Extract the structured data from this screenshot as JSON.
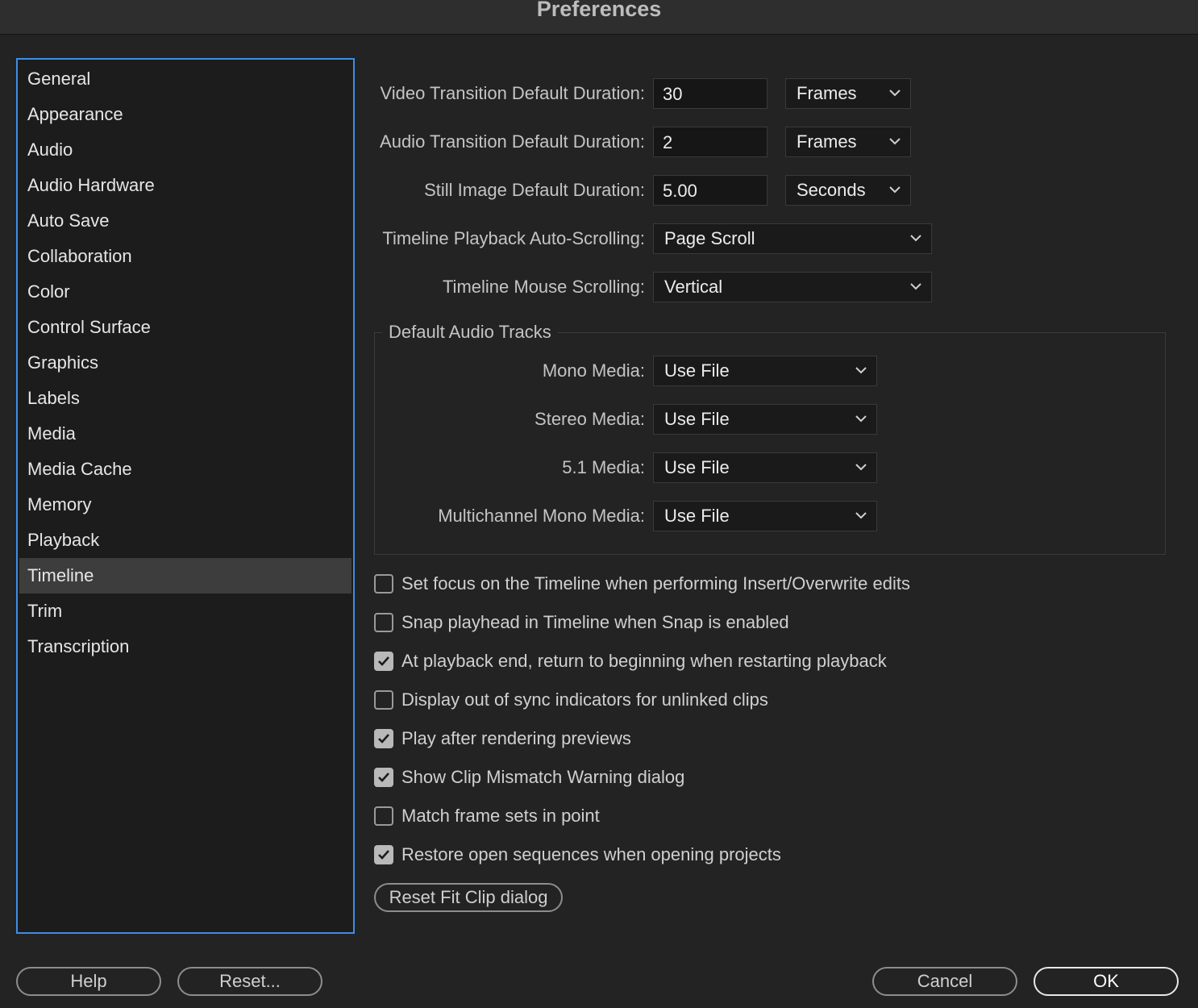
{
  "window": {
    "title": "Preferences"
  },
  "sidebar": {
    "items": [
      {
        "label": "General"
      },
      {
        "label": "Appearance"
      },
      {
        "label": "Audio"
      },
      {
        "label": "Audio Hardware"
      },
      {
        "label": "Auto Save"
      },
      {
        "label": "Collaboration"
      },
      {
        "label": "Color"
      },
      {
        "label": "Control Surface"
      },
      {
        "label": "Graphics"
      },
      {
        "label": "Labels"
      },
      {
        "label": "Media"
      },
      {
        "label": "Media Cache"
      },
      {
        "label": "Memory"
      },
      {
        "label": "Playback"
      },
      {
        "label": "Timeline"
      },
      {
        "label": "Trim"
      },
      {
        "label": "Transcription"
      }
    ],
    "selected": "Timeline"
  },
  "fields": {
    "video_transition": {
      "label": "Video Transition Default Duration:",
      "value": "30",
      "unit": "Frames"
    },
    "audio_transition": {
      "label": "Audio Transition Default Duration:",
      "value": "2",
      "unit": "Frames"
    },
    "still_image": {
      "label": "Still Image Default Duration:",
      "value": "5.00",
      "unit": "Seconds"
    },
    "auto_scrolling": {
      "label": "Timeline Playback Auto-Scrolling:",
      "value": "Page Scroll"
    },
    "mouse_scrolling": {
      "label": "Timeline Mouse Scrolling:",
      "value": "Vertical"
    }
  },
  "audio_tracks": {
    "title": "Default Audio Tracks",
    "mono": {
      "label": "Mono Media:",
      "value": "Use File"
    },
    "stereo": {
      "label": "Stereo Media:",
      "value": "Use File"
    },
    "surround": {
      "label": "5.1 Media:",
      "value": "Use File"
    },
    "multichannel": {
      "label": "Multichannel Mono Media:",
      "value": "Use File"
    }
  },
  "checkboxes": [
    {
      "label": "Set focus on the Timeline when performing Insert/Overwrite edits",
      "checked": false
    },
    {
      "label": "Snap playhead in Timeline when Snap is enabled",
      "checked": false
    },
    {
      "label": "At playback end, return to beginning when restarting playback",
      "checked": true
    },
    {
      "label": "Display out of sync indicators for unlinked clips",
      "checked": false
    },
    {
      "label": "Play after rendering previews",
      "checked": true
    },
    {
      "label": "Show Clip Mismatch Warning dialog",
      "checked": true
    },
    {
      "label": "Match frame sets in point",
      "checked": false
    },
    {
      "label": "Restore open sequences when opening projects",
      "checked": true
    }
  ],
  "buttons": {
    "reset_fit_clip": "Reset Fit Clip dialog",
    "help": "Help",
    "reset": "Reset...",
    "cancel": "Cancel",
    "ok": "OK"
  },
  "colors": {
    "accent": "#3d8ee6",
    "background": "#232323",
    "selected_item": "#3d3d3d"
  }
}
